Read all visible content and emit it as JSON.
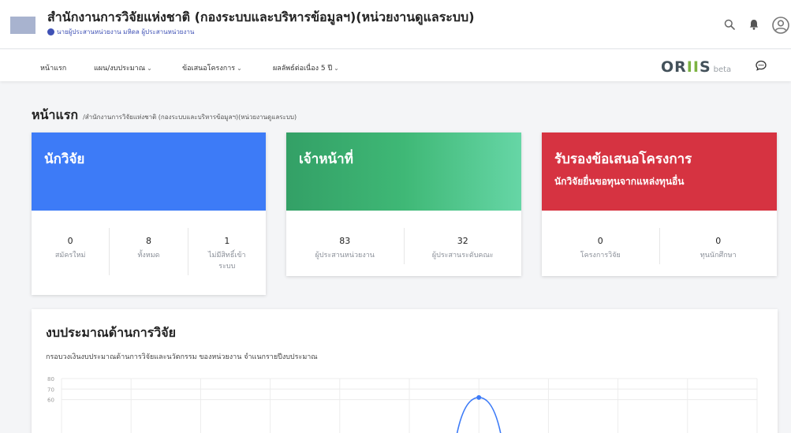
{
  "header": {
    "org_title": "สำนักงานการวิจัยแห่งชาติ (กองระบบและบริหารข้อมูลฯ)(หน่วยงานดูแลระบบ)",
    "user_line": "นายผู้ประสานหน่วยงาน มหิดล ผู้ประสานหน่วยงาน"
  },
  "nav": {
    "items": [
      {
        "label": "หน้าแรก",
        "dropdown": false
      },
      {
        "label": "แผน/งบประมาณ",
        "dropdown": true
      },
      {
        "label": "ข้อเสนอโครงการ",
        "dropdown": true
      },
      {
        "label": "ผลลัพธ์ต่อเนื่อง 5 ปี",
        "dropdown": true
      }
    ],
    "brand_pre": "OR",
    "brand_ii": "II",
    "brand_post": "S",
    "brand_beta": "beta"
  },
  "breadcrumb": {
    "title": "หน้าแรก",
    "path": "/สำนักงานการวิจัยแห่งชาติ (กองระบบและบริหารข้อมูลฯ)(หน่วยงานดูแลระบบ)"
  },
  "cards": [
    {
      "title": "นักวิจัย",
      "subtitle": "",
      "color": "#3d7bf7",
      "stats": [
        {
          "value": "0",
          "label": "สมัครใหม่"
        },
        {
          "value": "8",
          "label": "ทั้งหมด"
        },
        {
          "value": "1",
          "label": "ไม่มีสิทธิ์เข้าระบบ"
        }
      ]
    },
    {
      "title": "เจ้าหน้าที่",
      "subtitle": "",
      "color": "#3fb876",
      "stats": [
        {
          "value": "83",
          "label": "ผู้ประสานหน่วยงาน"
        },
        {
          "value": "32",
          "label": "ผู้ประสานระดับคณะ"
        }
      ]
    },
    {
      "title": "รับรองข้อเสนอโครงการ",
      "subtitle": "นักวิจัยยื่นขอทุนจากแหล่งทุนอื่น",
      "color": "#d63341",
      "stats": [
        {
          "value": "0",
          "label": "โครงการวิจัย"
        },
        {
          "value": "0",
          "label": "ทุนนักศึกษา"
        }
      ]
    }
  ],
  "budget": {
    "title": "งบประมาณด้านการวิจัย",
    "subtitle": "กรอบวงเงินงบประมาณด้านการวิจัยและนวัตกรรม ของหน่วยงาน จำแนกรายปีงบประมาณ"
  },
  "chart_data": {
    "type": "line",
    "yticks": [
      80,
      70,
      60
    ],
    "ylim": [
      0,
      80
    ],
    "x_gridlines": 11,
    "series": [
      {
        "values": [
          62
        ],
        "x_index": 6,
        "color": "#3d7bf7"
      }
    ]
  }
}
